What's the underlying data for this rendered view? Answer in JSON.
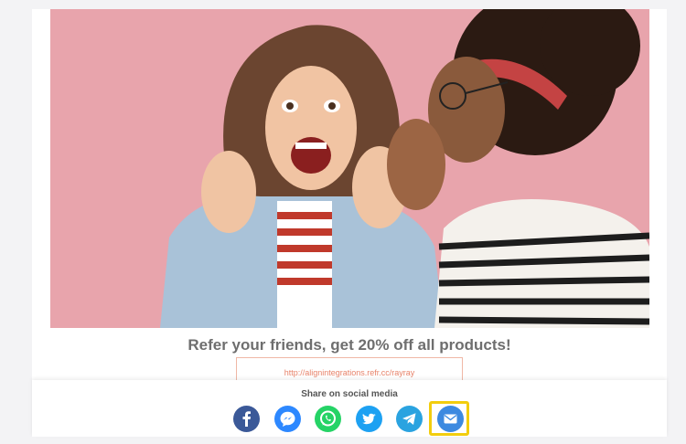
{
  "headline": "Refer your friends, get 20% off all products!",
  "referral_link": "http://alignintegrations.refr.cc/rayray",
  "share": {
    "label": "Share on social media",
    "buttons": [
      {
        "name": "facebook",
        "icon": "facebook-icon",
        "color": "#3b5998"
      },
      {
        "name": "messenger",
        "icon": "messenger-icon",
        "color": "#2d88ff"
      },
      {
        "name": "whatsapp",
        "icon": "whatsapp-icon",
        "color": "#25d366"
      },
      {
        "name": "twitter",
        "icon": "twitter-icon",
        "color": "#1da1f2"
      },
      {
        "name": "telegram",
        "icon": "telegram-icon",
        "color": "#2aa3e0"
      },
      {
        "name": "email",
        "icon": "email-icon",
        "color": "#3d8ae0",
        "highlighted": true
      }
    ]
  },
  "colors": {
    "hero_background": "#e8a4ac",
    "link_text": "#e8836a",
    "highlight": "#f2cd0e"
  }
}
